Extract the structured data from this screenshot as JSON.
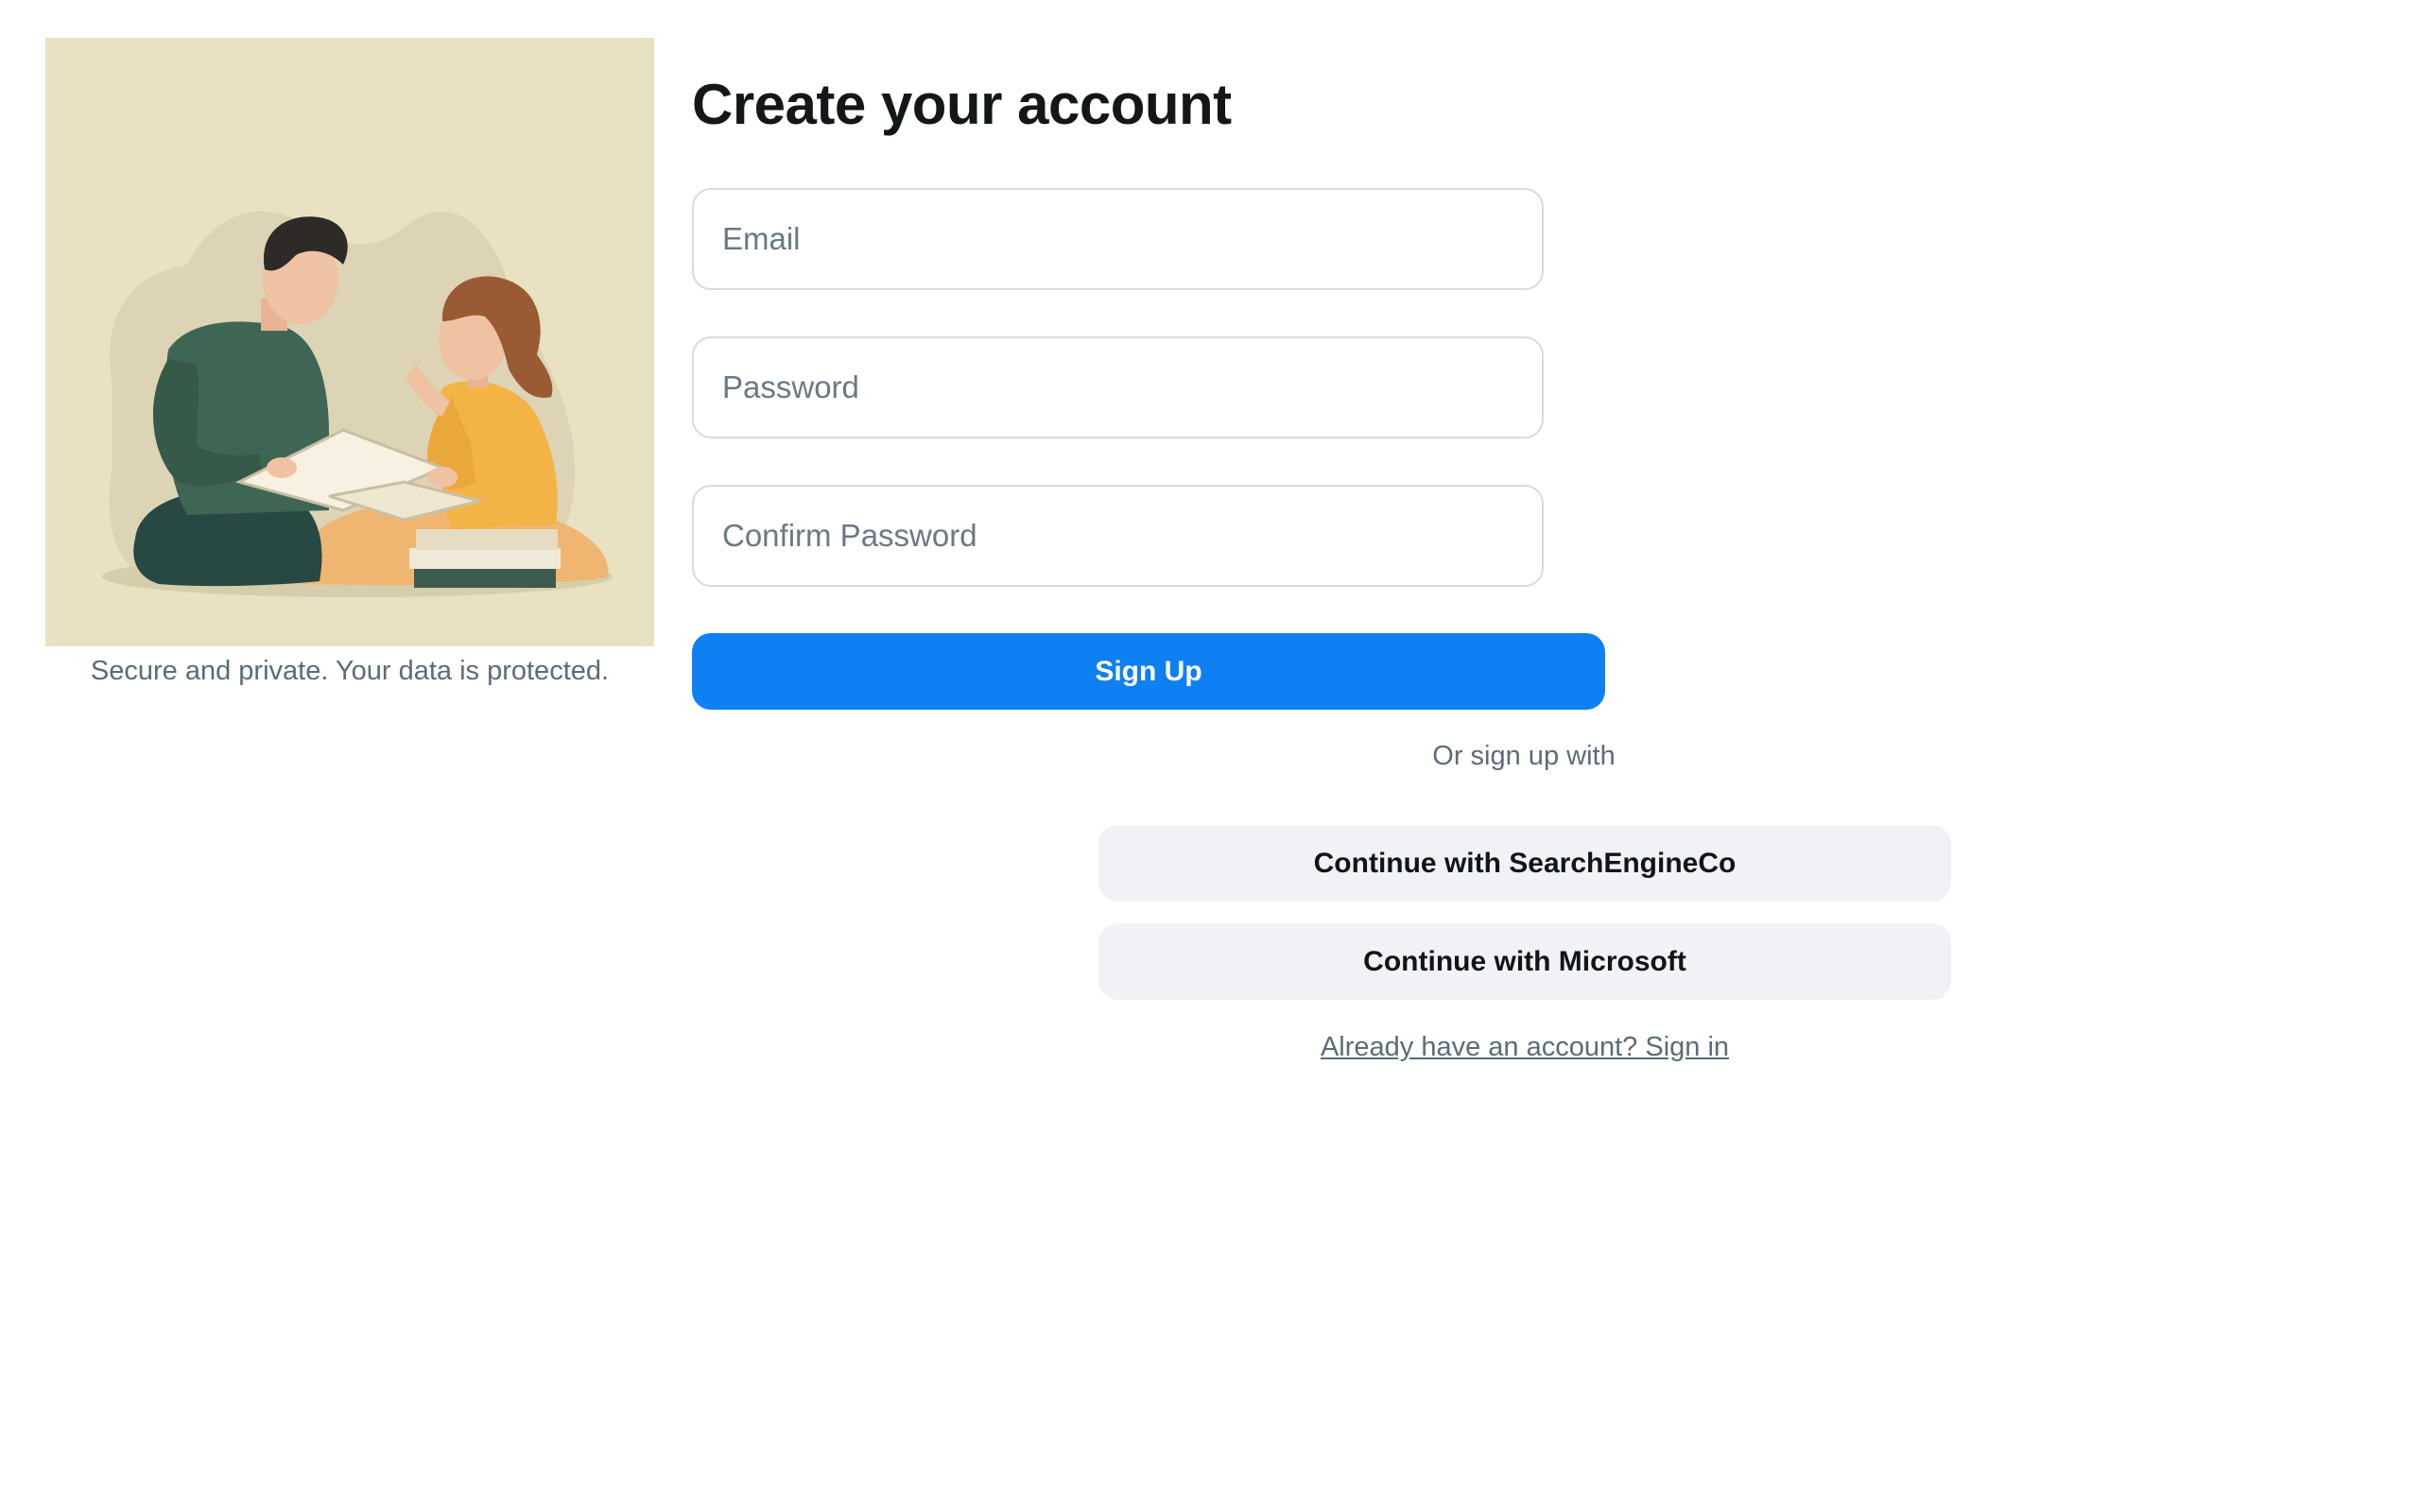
{
  "illustration": {
    "caption": "Secure and private. Your data is protected."
  },
  "form": {
    "title": "Create your account",
    "email_placeholder": "Email",
    "password_placeholder": "Password",
    "confirm_password_placeholder": "Confirm Password",
    "signup_label": "Sign Up"
  },
  "social": {
    "divider": "Or sign up with",
    "providers": [
      {
        "label": "Continue with SearchEngineCo"
      },
      {
        "label": "Continue with Microsoft"
      }
    ]
  },
  "footer": {
    "signin_link": "Already have an account? Sign in"
  },
  "colors": {
    "primary": "#0e80f2",
    "illustration_bg": "#e8e2c2",
    "social_bg": "#f0f2f5",
    "muted_text": "#5c6b7a"
  }
}
